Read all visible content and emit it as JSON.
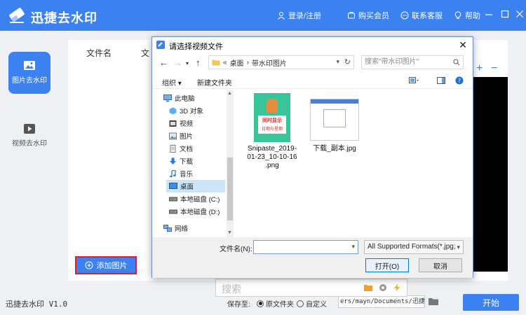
{
  "app": {
    "title": "迅捷去水印",
    "header_actions": [
      "登录/注册",
      "购买会员",
      "联系客服",
      "帮助"
    ],
    "accent": "#3b82f0"
  },
  "sidebar": {
    "items": [
      {
        "label": "图片去水印",
        "icon": "image-icon",
        "active": true
      },
      {
        "label": "视频去水印",
        "icon": "video-icon",
        "active": false
      }
    ]
  },
  "main": {
    "columns": [
      "文件名",
      "文"
    ],
    "zoom_in": "+",
    "zoom_out": "−",
    "add_button": "添加图片"
  },
  "status": {
    "version": "迅捷去水印 V1.0",
    "save_to": "保存至:",
    "options": [
      {
        "label": "原文件夹",
        "selected": true
      },
      {
        "label": "自定义",
        "selected": false
      }
    ],
    "path": "ers/mayn/Documents/迅捷去水印",
    "start": "开始"
  },
  "search_popup": {
    "placeholder": "搜索"
  },
  "dialog": {
    "title": "请选择视频文件",
    "close": "✕",
    "address": {
      "prefix": "«",
      "segments": [
        "桌面",
        "带水印图片"
      ],
      "sep": "›"
    },
    "search_placeholder": "搜索\"带水印图片\"",
    "toolbar": {
      "organize": "组织 ▾",
      "new_folder": "新建文件夹"
    },
    "tree": [
      {
        "label": "此电脑",
        "icon": "computer-icon",
        "level": "top",
        "selected": false
      },
      {
        "label": "3D 对象",
        "icon": "cube-icon",
        "level": "child",
        "selected": false
      },
      {
        "label": "视频",
        "icon": "video-folder-icon",
        "level": "child",
        "selected": false
      },
      {
        "label": "图片",
        "icon": "picture-folder-icon",
        "level": "child",
        "selected": false
      },
      {
        "label": "文档",
        "icon": "document-icon",
        "level": "child",
        "selected": false
      },
      {
        "label": "下载",
        "icon": "download-icon",
        "level": "child",
        "selected": false
      },
      {
        "label": "音乐",
        "icon": "music-icon",
        "level": "child",
        "selected": false
      },
      {
        "label": "桌面",
        "icon": "desktop-icon",
        "level": "child",
        "selected": true
      },
      {
        "label": "本地磁盘 (C:)",
        "icon": "drive-icon",
        "level": "child",
        "selected": false
      },
      {
        "label": "本地磁盘 (D:)",
        "icon": "drive-icon",
        "level": "child",
        "selected": false
      },
      {
        "label": "网络",
        "icon": "network-icon",
        "level": "top",
        "selected": false
      }
    ],
    "files": [
      {
        "name_lines": [
          "Snipaste_2019-",
          "01-23_10-10-16",
          ".png"
        ],
        "thumb_text": [
          "同时显示",
          "日期与星期"
        ]
      },
      {
        "name_lines": [
          "下载_副本.jpg"
        ]
      }
    ],
    "filename_label": "文件名(N):",
    "filename_value": "",
    "format": "All Supported Formats(*.jpg;",
    "open": "打开(O)",
    "cancel": "取消"
  }
}
